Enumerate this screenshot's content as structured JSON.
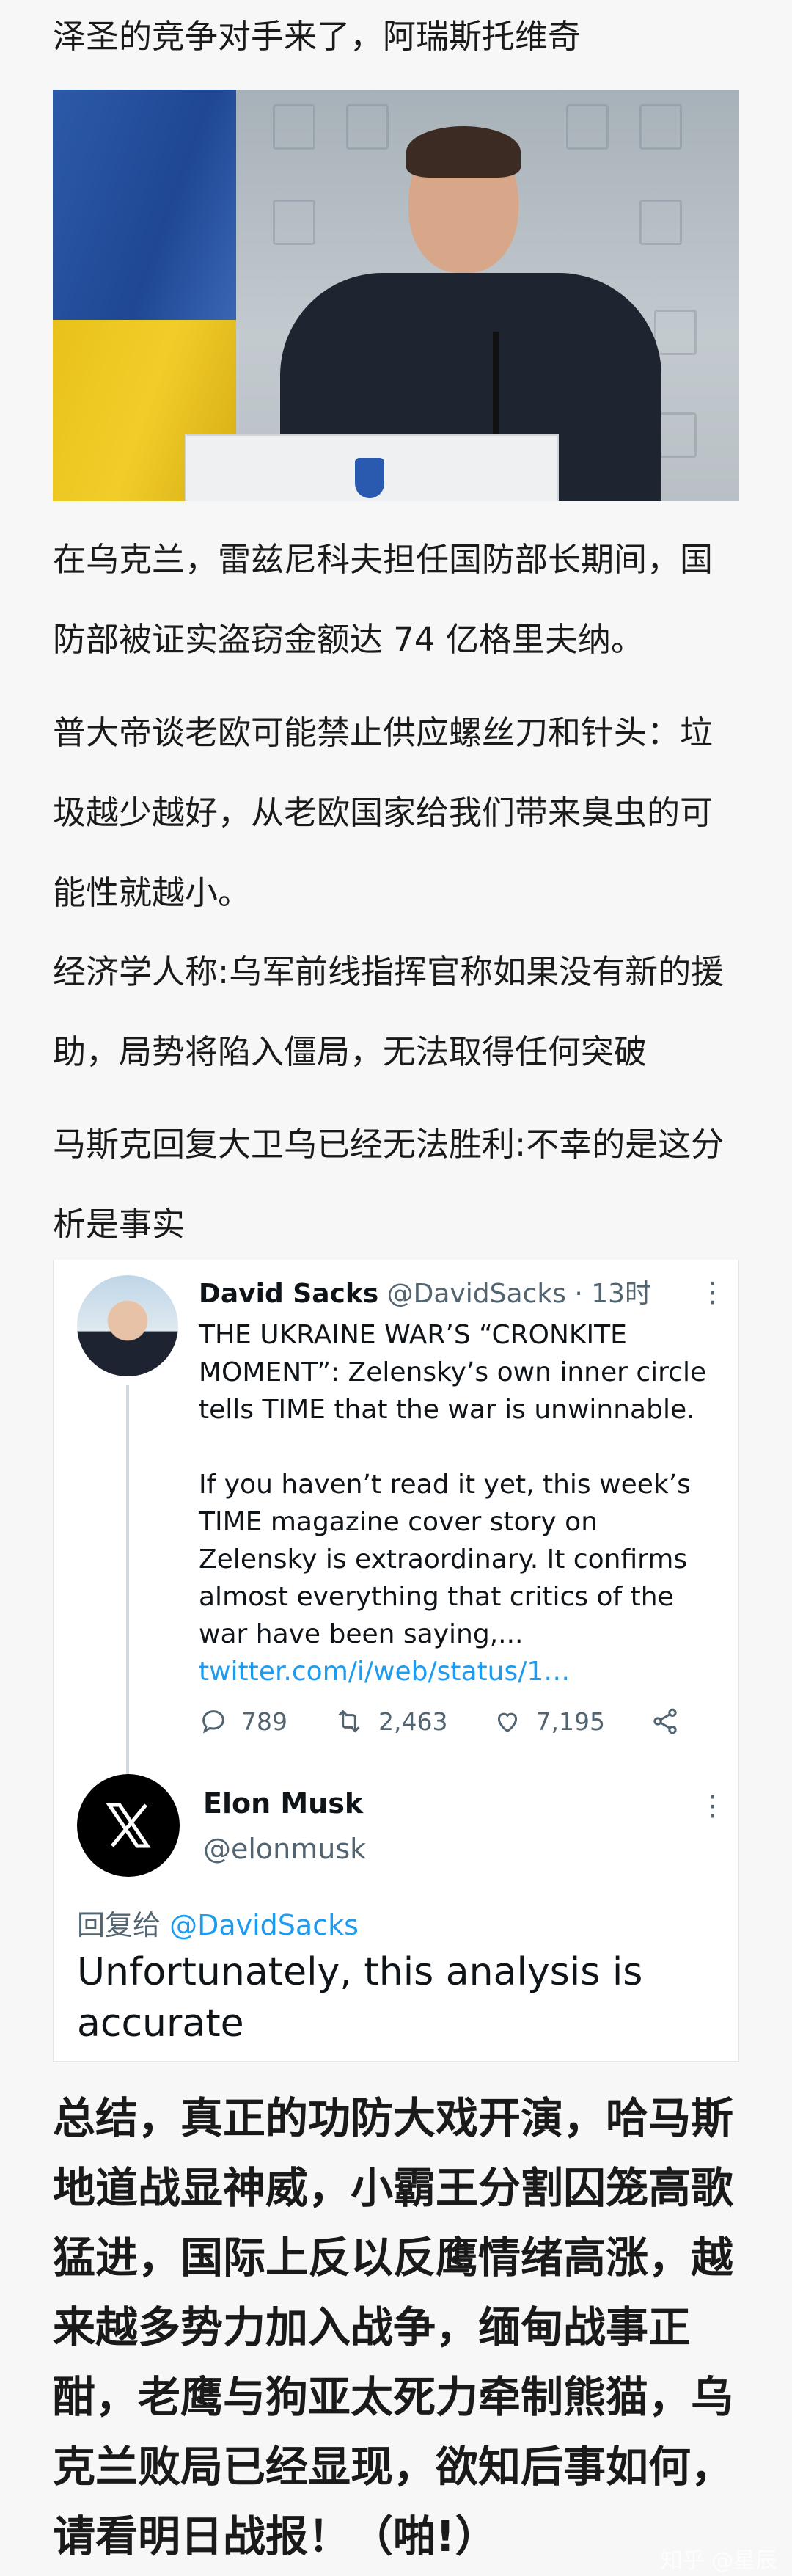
{
  "article": {
    "title": "泽圣的竞争对手来了，阿瑞斯托维奇",
    "paragraphs": [
      "在乌克兰，雷兹尼科夫担任国防部长期间，国防部被证实盗窃金额达 74 亿格里夫纳。",
      "普大帝谈老欧可能禁止供应螺丝刀和针头：垃圾越少越好，从老欧国家给我们带来臭虫的可能性就越小。",
      "经济学人称:乌军前线指挥官称如果没有新的援助，局势将陷入僵局，无法取得任何突破",
      "马斯克回复大卫乌已经无法胜利:不幸的是这分析是事实"
    ],
    "summary": "总结，真正的功防大戏开演，哈马斯地道战显神威，小霸王分割囚笼高歌猛进，国际上反以反鹰情绪高涨，越来越多势力加入战争，缅甸战事正酣，老鹰与狗亚太死力牵制熊猫，乌克兰败局已经显现，欲知后事如何，请看明日战报！（啪!）",
    "watermark": "知乎 @星辰"
  },
  "tweet": {
    "author_name": "David Sacks",
    "author_handle": "@DavidSacks",
    "time": "· 13时",
    "para1": "THE UKRAINE WAR’S “CRONKITE MOMENT”: Zelensky’s own inner circle tells TIME that the war is unwinnable.",
    "para2": "If you haven’t read it yet, this week’s TIME magazine cover story on Zelensky is extraordinary. It confirms almost everything that critics of the war have been saying,... ",
    "link": "twitter.com/i/web/status/1…",
    "replies": "789",
    "retweets": "2,463",
    "likes": "7,195",
    "more_glyph": "⋮"
  },
  "reply": {
    "author_name": "Elon Musk",
    "author_handle": "@elonmusk",
    "reply_prefix": "回复给 ",
    "reply_to": "@DavidSacks",
    "text": "Unfortunately, this analysis is accurate",
    "more_glyph": "⋮"
  },
  "colors": {
    "link": "#1d9bf0",
    "muted": "#536471",
    "background": "#f7f7f7"
  }
}
